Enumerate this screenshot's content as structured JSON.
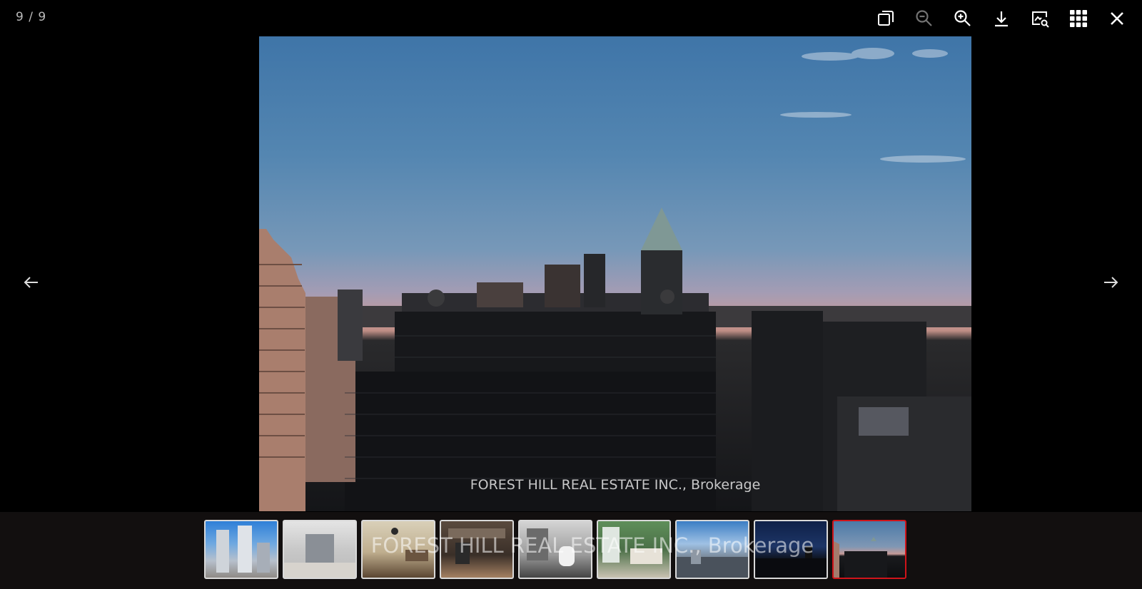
{
  "viewer": {
    "counter": "9 / 9",
    "caption": "FOREST HILL REAL ESTATE INC., Brokerage",
    "filmstrip_watermark": "FOREST HILL REAL ESTATE INC., Brokerage"
  },
  "toolbar": [
    {
      "name": "toggle-size-button",
      "icon": "square-stack-icon",
      "enabled": true
    },
    {
      "name": "zoom-out-button",
      "icon": "zoom-out-icon",
      "enabled": false
    },
    {
      "name": "zoom-in-button",
      "icon": "zoom-in-icon",
      "enabled": true
    },
    {
      "name": "download-button",
      "icon": "download-icon",
      "enabled": true
    },
    {
      "name": "slideshow-button",
      "icon": "image-search-icon",
      "enabled": true
    },
    {
      "name": "thumbnails-button",
      "icon": "grid-icon",
      "enabled": true
    },
    {
      "name": "close-button",
      "icon": "close-icon",
      "enabled": true
    }
  ],
  "navigation": {
    "prev_icon": "arrow-left-icon",
    "next_icon": "arrow-right-icon"
  },
  "thumbnails": [
    {
      "index": 1,
      "scene": "tower-exterior",
      "active": false
    },
    {
      "index": 2,
      "scene": "building-entrance",
      "active": false
    },
    {
      "index": 3,
      "scene": "living-room",
      "active": false
    },
    {
      "index": 4,
      "scene": "kitchen",
      "active": false
    },
    {
      "index": 5,
      "scene": "bathroom",
      "active": false
    },
    {
      "index": 6,
      "scene": "bedroom",
      "active": false
    },
    {
      "index": 7,
      "scene": "city-view-day",
      "active": false
    },
    {
      "index": 8,
      "scene": "city-view-dusk",
      "active": false
    },
    {
      "index": 9,
      "scene": "city-view-sunset",
      "active": true
    }
  ],
  "colors": {
    "active_thumb_border": "#d0141a",
    "background": "#000000",
    "filmstrip_background": "#120f0f"
  }
}
